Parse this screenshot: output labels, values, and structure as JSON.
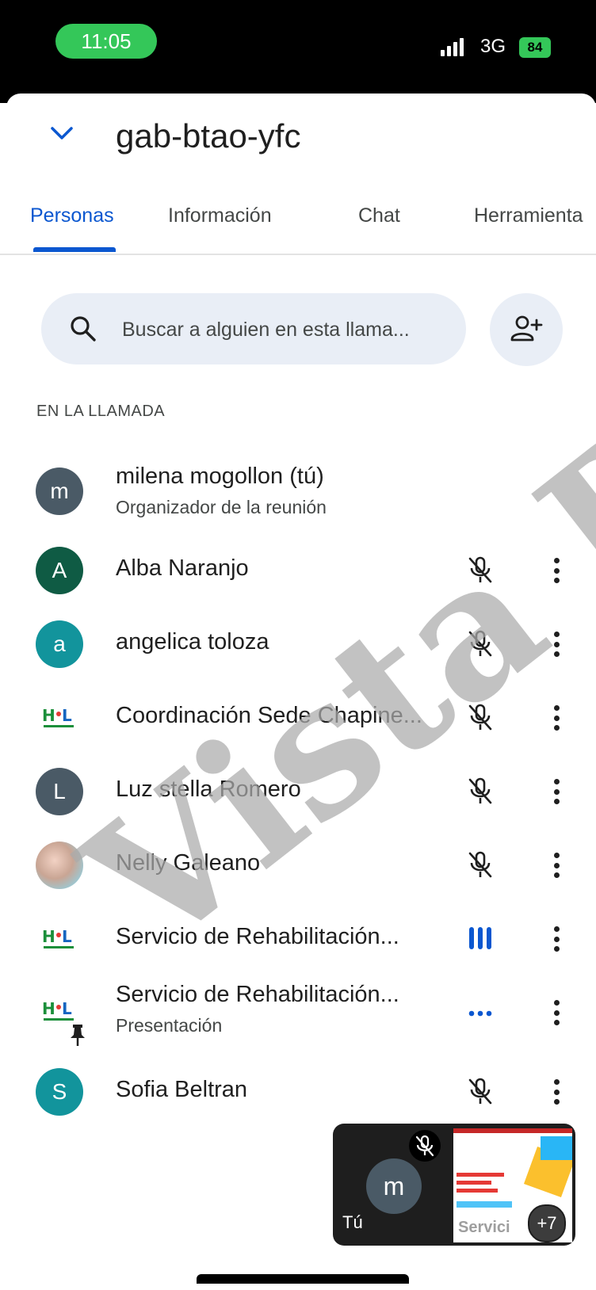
{
  "status_bar": {
    "time": "11:05",
    "network": "3G",
    "battery": "84"
  },
  "header": {
    "title": "gab-btao-yfc",
    "collapse_icon": "chevron-down-icon"
  },
  "tabs": [
    {
      "label": "Personas",
      "active": true
    },
    {
      "label": "Información",
      "active": false
    },
    {
      "label": "Chat",
      "active": false
    },
    {
      "label": "Herramienta",
      "active": false
    }
  ],
  "search": {
    "placeholder": "Buscar a alguien en esta llama...",
    "icon": "search-icon"
  },
  "add_people_icon": "add-person-icon",
  "section_label": "EN LA LLAMADA",
  "participants": [
    {
      "initial": "m",
      "avatar_color": "#4a5a66",
      "name": "milena mogollon (tú)",
      "sub": "Organizador de la reunión",
      "status": "none"
    },
    {
      "initial": "A",
      "avatar_color": "#0f5b44",
      "name": "Alba Naranjo",
      "sub": "",
      "status": "muted"
    },
    {
      "initial": "a",
      "avatar_color": "#12949c",
      "name": "angelica toloza",
      "sub": "",
      "status": "muted"
    },
    {
      "initial": "",
      "avatar_color": "",
      "name": "Coordinación Sede Chapine...",
      "sub": "",
      "status": "muted"
    },
    {
      "initial": "L",
      "avatar_color": "#4a5a66",
      "name": "Luz stella Romero",
      "sub": "",
      "status": "muted"
    },
    {
      "initial": "",
      "avatar_color": "",
      "name": "Nelly Galeano",
      "sub": "",
      "status": "muted"
    },
    {
      "initial": "",
      "avatar_color": "",
      "name": "Servicio de Rehabilitación...",
      "sub": "",
      "status": "speaking"
    },
    {
      "initial": "",
      "avatar_color": "",
      "name": "Servicio de Rehabilitación...",
      "sub": "Presentación",
      "status": "presenting"
    },
    {
      "initial": "S",
      "avatar_color": "#12949c",
      "name": "Sofia Beltran",
      "sub": "",
      "status": "muted"
    }
  ],
  "pip": {
    "self_initial": "m",
    "self_label": "Tú",
    "presenter_label": "Servici",
    "more_count": "+7"
  },
  "watermark": "Vista Pr",
  "colors": {
    "accent": "#0b57d0",
    "status_green": "#34c759",
    "search_bg": "#e9eef6"
  }
}
